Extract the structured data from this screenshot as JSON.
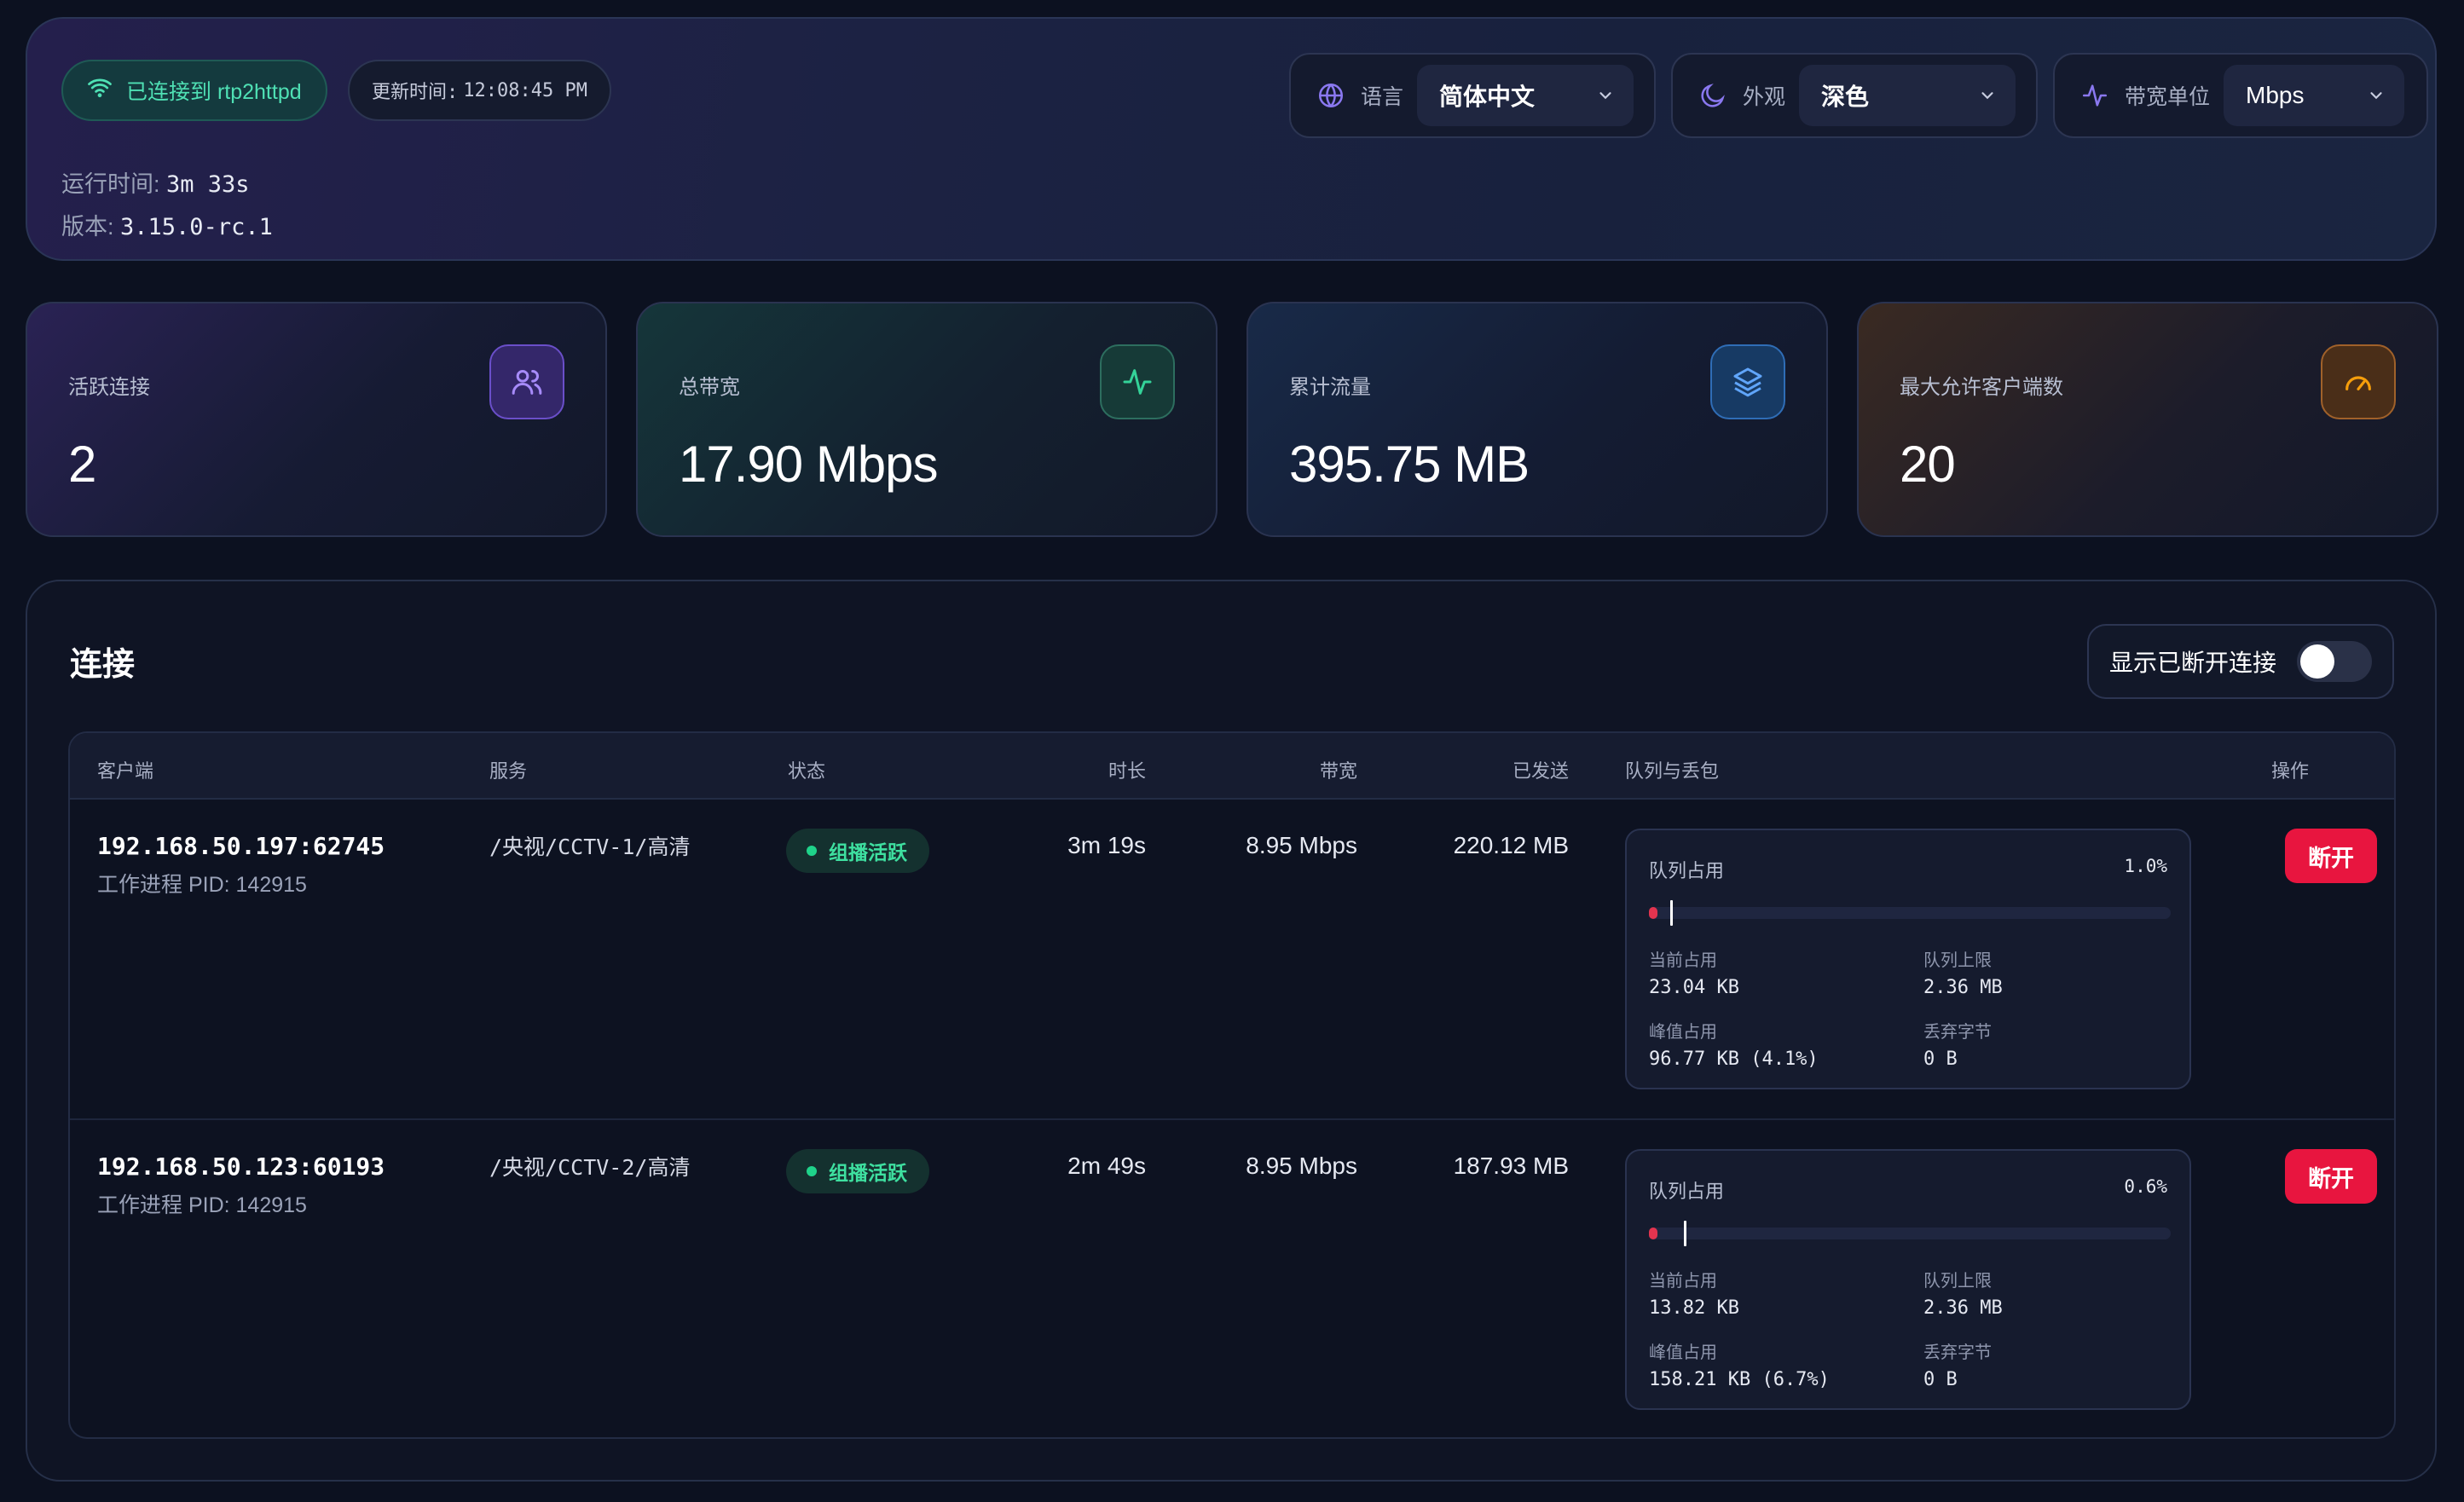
{
  "header": {
    "connected_text": "已连接到 rtp2httpd",
    "update_label": "更新时间:",
    "update_time": "12:08:45 PM",
    "uptime_label": "运行时间:",
    "uptime_value": "3m 33s",
    "version_label": "版本:",
    "version_value": "3.15.0-rc.1",
    "language": {
      "label": "语言",
      "value": "简体中文"
    },
    "theme": {
      "label": "外观",
      "value": "深色"
    },
    "unit": {
      "label": "带宽单位",
      "value": "Mbps"
    }
  },
  "stats": [
    {
      "title": "活跃连接",
      "value": "2",
      "icon": "users-icon"
    },
    {
      "title": "总带宽",
      "value": "17.90 Mbps",
      "icon": "activity-icon"
    },
    {
      "title": "累计流量",
      "value": "395.75 MB",
      "icon": "layers-icon"
    },
    {
      "title": "最大允许客户端数",
      "value": "20",
      "icon": "gauge-icon"
    }
  ],
  "connections": {
    "title": "连接",
    "toggle_label": "显示已断开连接",
    "toggle_on": false,
    "columns": [
      "客户端",
      "服务",
      "状态",
      "时长",
      "带宽",
      "已发送",
      "队列与丢包",
      "操作"
    ],
    "rows": [
      {
        "client": "192.168.50.197:62745",
        "pid": "工作进程 PID: 142915",
        "service": "/央视/CCTV-1/高清",
        "status": "组播活跃",
        "duration": "3m 19s",
        "bandwidth": "8.95 Mbps",
        "sent": "220.12 MB",
        "queue": {
          "title": "队列占用",
          "pct": "1.0%",
          "fill": 0.01,
          "peak_mark": 0.041,
          "current_label": "当前占用",
          "current": "23.04 KB",
          "limit_label": "队列上限",
          "limit": "2.36 MB",
          "peak_label": "峰值占用",
          "peak": "96.77 KB (4.1%)",
          "drop_label": "丢弃字节",
          "drop": "0 B"
        },
        "action": "断开"
      },
      {
        "client": "192.168.50.123:60193",
        "pid": "工作进程 PID: 142915",
        "service": "/央视/CCTV-2/高清",
        "status": "组播活跃",
        "duration": "2m 49s",
        "bandwidth": "8.95 Mbps",
        "sent": "187.93 MB",
        "queue": {
          "title": "队列占用",
          "pct": "0.6%",
          "fill": 0.006,
          "peak_mark": 0.067,
          "current_label": "当前占用",
          "current": "13.82 KB",
          "limit_label": "队列上限",
          "limit": "2.36 MB",
          "peak_label": "峰值占用",
          "peak": "158.21 KB (6.7%)",
          "drop_label": "丢弃字节",
          "drop": "0 B"
        },
        "action": "断开"
      }
    ]
  },
  "colors": {
    "accent_green": "#3ee0a0",
    "danger": "#e8153f",
    "background": "#0c1120"
  }
}
